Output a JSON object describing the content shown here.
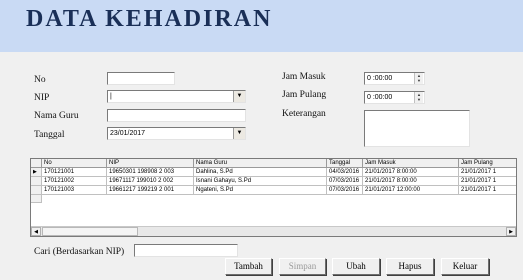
{
  "header": {
    "title": "DATA KEHADIRAN"
  },
  "form": {
    "no_label": "No",
    "no_value": "",
    "nip_label": "NIP",
    "nip_value": "|",
    "nama_label": "Nama Guru",
    "nama_value": "",
    "tanggal_label": "Tanggal",
    "tanggal_value": "23/01/2017",
    "jam_masuk_label": "Jam Masuk",
    "jam_masuk_value": "0 :00:00",
    "jam_pulang_label": "Jam Pulang",
    "jam_pulang_value": "0 :00:00",
    "keterangan_label": "Keterangan",
    "keterangan_value": ""
  },
  "grid": {
    "columns": [
      "No",
      "NIP",
      "Nama Guru",
      "Tanggal",
      "Jam Masuk",
      "Jam Pulang"
    ],
    "rows": [
      {
        "no": "170121001",
        "nip": "19650301 198908 2 003",
        "nama": "Dahlina, S.Pd",
        "tanggal": "04/03/2016",
        "jam_masuk": "21/01/2017 8:00:00",
        "jam_pulang": "21/01/2017 1",
        "current": true
      },
      {
        "no": "170121002",
        "nip": "19671117 199010 2 002",
        "nama": "Isnani Gahayu, S.Pd",
        "tanggal": "07/03/2016",
        "jam_masuk": "21/01/2017 8:00:00",
        "jam_pulang": "21/01/2017 1",
        "current": false
      },
      {
        "no": "170121003",
        "nip": "19661217 199219 2 001",
        "nama": "Ngateni, S.Pd",
        "tanggal": "07/03/2016",
        "jam_masuk": "21/01/2017 12:00:00",
        "jam_pulang": "21/01/2017 1",
        "current": false
      }
    ]
  },
  "search": {
    "label": "Cari (Berdasarkan NIP)",
    "value": ""
  },
  "buttons": {
    "tambah": "Tambah",
    "simpan": "Simpan",
    "ubah": "Ubah",
    "hapus": "Hapus",
    "keluar": "Keluar"
  },
  "icons": {
    "row_pointer": "▶",
    "combo_arrow": "▼",
    "scroll_left": "◀",
    "scroll_right": "▶",
    "spin_up": "▲",
    "spin_down": "▼"
  }
}
